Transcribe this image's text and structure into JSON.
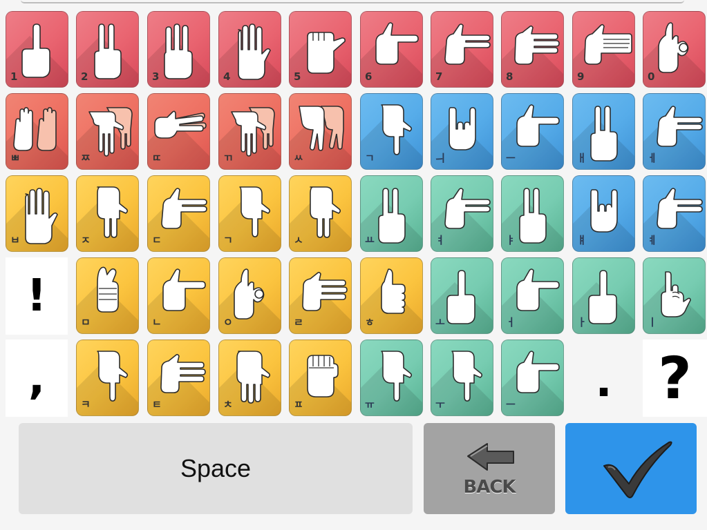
{
  "keyboard": {
    "rows": [
      [
        {
          "label": "1",
          "color": "red",
          "hand": "finger-1"
        },
        {
          "label": "2",
          "color": "red",
          "hand": "finger-2"
        },
        {
          "label": "3",
          "color": "red",
          "hand": "finger-3"
        },
        {
          "label": "4",
          "color": "red",
          "hand": "finger-4"
        },
        {
          "label": "5",
          "color": "red",
          "hand": "fist-thumb"
        },
        {
          "label": "6",
          "color": "red",
          "hand": "point-right"
        },
        {
          "label": "7",
          "color": "red",
          "hand": "two-right"
        },
        {
          "label": "8",
          "color": "red",
          "hand": "three-right"
        },
        {
          "label": "9",
          "color": "red",
          "hand": "flat-right"
        },
        {
          "label": "0",
          "color": "red",
          "hand": "ok-sign"
        }
      ],
      [
        {
          "label": "ㅃ",
          "color": "red2",
          "hand": "double-palm"
        },
        {
          "label": "ㅉ",
          "color": "red2",
          "hand": "double-down"
        },
        {
          "label": "ㄸ",
          "color": "red2",
          "hand": "double-side"
        },
        {
          "label": "ㄲ",
          "color": "red2",
          "hand": "double-down"
        },
        {
          "label": "ㅆ",
          "color": "red2",
          "hand": "double-v"
        },
        {
          "label": "ㄱ",
          "color": "blue",
          "hand": "point-down"
        },
        {
          "label": "ㅢ",
          "color": "blue",
          "hand": "rock-horns"
        },
        {
          "label": "ㅡ",
          "color": "blue",
          "hand": "point-right"
        },
        {
          "label": "ㅐ",
          "color": "blue",
          "hand": "finger-2"
        },
        {
          "label": "ㅔ",
          "color": "blue",
          "hand": "two-right"
        }
      ],
      [
        {
          "label": "ㅂ",
          "color": "yellow",
          "hand": "finger-4"
        },
        {
          "label": "ㅈ",
          "color": "yellow",
          "hand": "two-down"
        },
        {
          "label": "ㄷ",
          "color": "yellow",
          "hand": "two-right"
        },
        {
          "label": "ㄱ",
          "color": "yellow",
          "hand": "point-down"
        },
        {
          "label": "ㅅ",
          "color": "yellow",
          "hand": "two-down"
        },
        {
          "label": "ㅛ",
          "color": "green",
          "hand": "finger-2"
        },
        {
          "label": "ㅕ",
          "color": "green",
          "hand": "two-right"
        },
        {
          "label": "ㅑ",
          "color": "green",
          "hand": "finger-2"
        },
        {
          "label": "ㅒ",
          "color": "blue",
          "hand": "rock-horns"
        },
        {
          "label": "ㅖ",
          "color": "blue",
          "hand": "two-right"
        }
      ],
      [
        {
          "punct": "!"
        },
        {
          "label": "ㅁ",
          "color": "yellow",
          "hand": "crossed"
        },
        {
          "label": "ㄴ",
          "color": "yellow",
          "hand": "point-right"
        },
        {
          "label": "ㅇ",
          "color": "yellow",
          "hand": "ok-sign"
        },
        {
          "label": "ㄹ",
          "color": "yellow",
          "hand": "three-right"
        },
        {
          "label": "ㅎ",
          "color": "yellow",
          "hand": "thumbs-up"
        },
        {
          "label": "ㅗ",
          "color": "green",
          "hand": "finger-1"
        },
        {
          "label": "ㅓ",
          "color": "green",
          "hand": "point-right"
        },
        {
          "label": "ㅏ",
          "color": "green",
          "hand": "finger-1"
        },
        {
          "label": "ㅣ",
          "color": "green",
          "hand": "pinky-up"
        }
      ],
      [
        {
          "punct": ","
        },
        {
          "label": "ㅋ",
          "color": "yellow",
          "hand": "point-down"
        },
        {
          "label": "ㅌ",
          "color": "yellow",
          "hand": "three-right"
        },
        {
          "label": "ㅊ",
          "color": "yellow",
          "hand": "three-down"
        },
        {
          "label": "ㅍ",
          "color": "yellow",
          "hand": "fist"
        },
        {
          "label": "ㅠ",
          "color": "green",
          "hand": "point-down"
        },
        {
          "label": "ㅜ",
          "color": "green",
          "hand": "point-down"
        },
        {
          "label": "ㅡ",
          "color": "green",
          "hand": "point-right"
        },
        {
          "punct": "."
        },
        {
          "punct": "?"
        }
      ]
    ]
  },
  "controls": {
    "space_label": "Space",
    "back_label": "BACK",
    "back_icon": "arrow-left-icon",
    "ok_icon": "checkmark-icon"
  },
  "colors": {
    "red": "#e96470",
    "blue": "#56ace9",
    "yellow": "#fbc43f",
    "green": "#77ccb1",
    "space_bg": "#e0e0e0",
    "back_bg": "#a3a3a3",
    "ok_bg": "#2e94ea"
  }
}
